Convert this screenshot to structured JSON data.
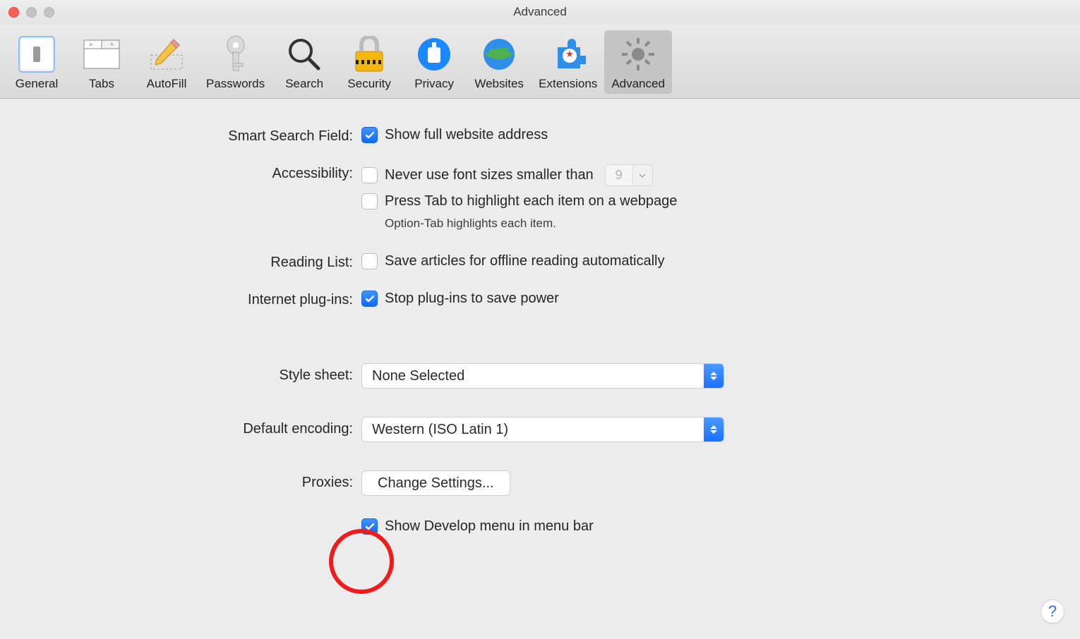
{
  "window": {
    "title": "Advanced"
  },
  "toolbar": {
    "items": [
      {
        "label": "General"
      },
      {
        "label": "Tabs"
      },
      {
        "label": "AutoFill"
      },
      {
        "label": "Passwords"
      },
      {
        "label": "Search"
      },
      {
        "label": "Security"
      },
      {
        "label": "Privacy"
      },
      {
        "label": "Websites"
      },
      {
        "label": "Extensions"
      },
      {
        "label": "Advanced"
      }
    ]
  },
  "sections": {
    "smartSearch": {
      "label": "Smart Search Field:",
      "showFullAddress": {
        "text": "Show full website address",
        "checked": true
      }
    },
    "accessibility": {
      "label": "Accessibility:",
      "minFont": {
        "text": "Never use font sizes smaller than",
        "checked": false,
        "value": "9"
      },
      "pressTab": {
        "text": "Press Tab to highlight each item on a webpage",
        "checked": false
      },
      "hint": "Option-Tab highlights each item."
    },
    "readingList": {
      "label": "Reading List:",
      "saveOffline": {
        "text": "Save articles for offline reading automatically",
        "checked": false
      }
    },
    "plugins": {
      "label": "Internet plug-ins:",
      "stopPlugins": {
        "text": "Stop plug-ins to save power",
        "checked": true
      }
    },
    "stylesheet": {
      "label": "Style sheet:",
      "value": "None Selected"
    },
    "encoding": {
      "label": "Default encoding:",
      "value": "Western (ISO Latin 1)"
    },
    "proxies": {
      "label": "Proxies:",
      "button": "Change Settings..."
    },
    "develop": {
      "text": "Show Develop menu in menu bar",
      "checked": true
    }
  },
  "help": "?"
}
